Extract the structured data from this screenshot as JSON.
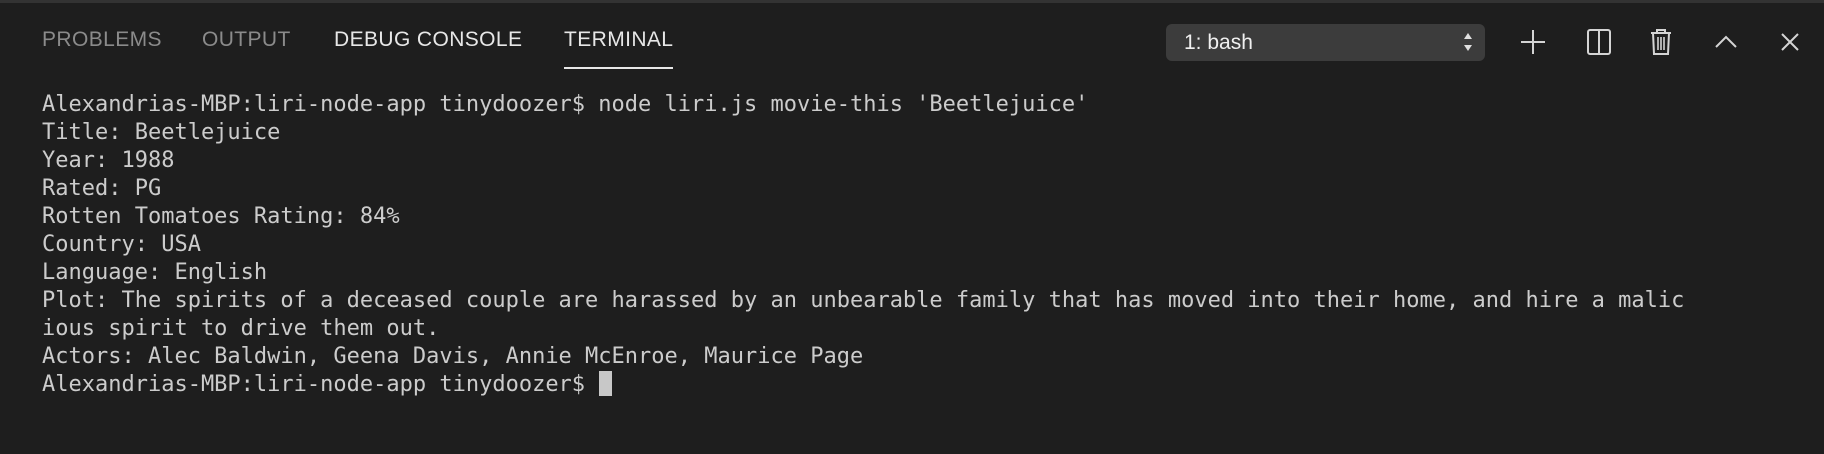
{
  "tabs": [
    {
      "label": "PROBLEMS"
    },
    {
      "label": "OUTPUT"
    },
    {
      "label": "DEBUG CONSOLE"
    },
    {
      "label": "TERMINAL"
    }
  ],
  "terminal_select": {
    "value": "1: bash"
  },
  "actions": [
    {
      "icon": "plus-icon",
      "label": "new-terminal"
    },
    {
      "icon": "split-icon",
      "label": "split-terminal"
    },
    {
      "icon": "trash-icon",
      "label": "kill-terminal"
    },
    {
      "icon": "chevron-up-icon",
      "label": "maximize-panel"
    },
    {
      "icon": "close-icon",
      "label": "close-panel"
    }
  ],
  "terminal": {
    "lines": [
      "Alexandrias-MBP:liri-node-app tinydoozer$ node liri.js movie-this 'Beetlejuice'",
      "Title: Beetlejuice",
      "Year: 1988",
      "Rated: PG",
      "Rotten Tomatoes Rating: 84%",
      "Country: USA",
      "Language: English",
      "Plot: The spirits of a deceased couple are harassed by an unbearable family that has moved into their home, and hire a malic",
      "ious spirit to drive them out.",
      "Actors: Alec Baldwin, Geena Davis, Annie McEnroe, Maurice Page"
    ],
    "prompt": "Alexandrias-MBP:liri-node-app tinydoozer$ "
  }
}
